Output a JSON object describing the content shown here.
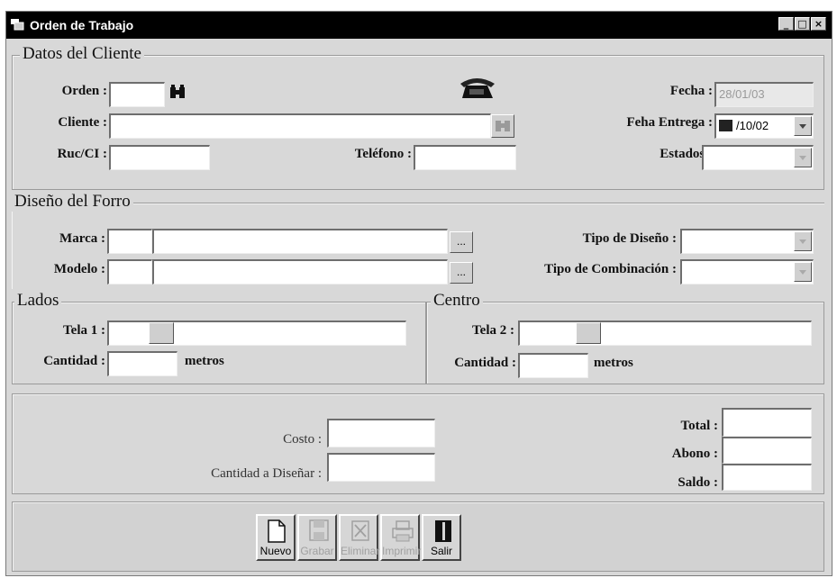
{
  "window": {
    "title": "Orden de Trabajo",
    "buttons": [
      "_",
      "□",
      "×"
    ]
  },
  "datos_cliente": {
    "legend": "Datos del Cliente",
    "orden_label": "Orden :",
    "orden_value": "",
    "cliente_label": "Cliente :",
    "cliente_value": "",
    "ruc_label": "Ruc/CI :",
    "ruc_value": "",
    "telefono_label": "Teléfono :",
    "telefono_value": "",
    "fecha_label": "Fecha :",
    "fecha_value": "28/01/03",
    "feha_entrega_label": "Feha Entrega :",
    "feha_entrega_value": "/10/02",
    "estados_label": "Estados :",
    "estados_value": ""
  },
  "diseno_forro": {
    "legend": "Diseño del Forro",
    "marca_label": "Marca :",
    "modelo_label": "Modelo :",
    "tipo_diseno_label": "Tipo de Diseño :",
    "tipo_combinacion_label": "Tipo de Combinación :",
    "dots": "..."
  },
  "lados": {
    "legend": "Lados",
    "tela_label": "Tela 1 :",
    "cantidad_label": "Cantidad :",
    "unit": "metros"
  },
  "centro": {
    "legend": "Centro",
    "tela_label": "Tela 2 :",
    "cantidad_label": "Cantidad :",
    "unit": "metros"
  },
  "totales": {
    "costo_label": "Costo :",
    "cantidad_disenar_label": "Cantidad a Diseñar :",
    "total_label": "Total :",
    "abono_label": "Abono :",
    "saldo_label": "Saldo :"
  },
  "toolbar": {
    "nuevo": "Nuevo",
    "grabar": "Grabar",
    "eliminar": "Eliminar",
    "imprimir": "Imprimir",
    "salir": "Salir"
  },
  "icons": [
    "window-icon",
    "binoculars-icon",
    "phone-icon",
    "calendar-icon",
    "new-document-icon",
    "save-disk-icon",
    "delete-icon",
    "printer-icon",
    "exit-door-icon"
  ]
}
